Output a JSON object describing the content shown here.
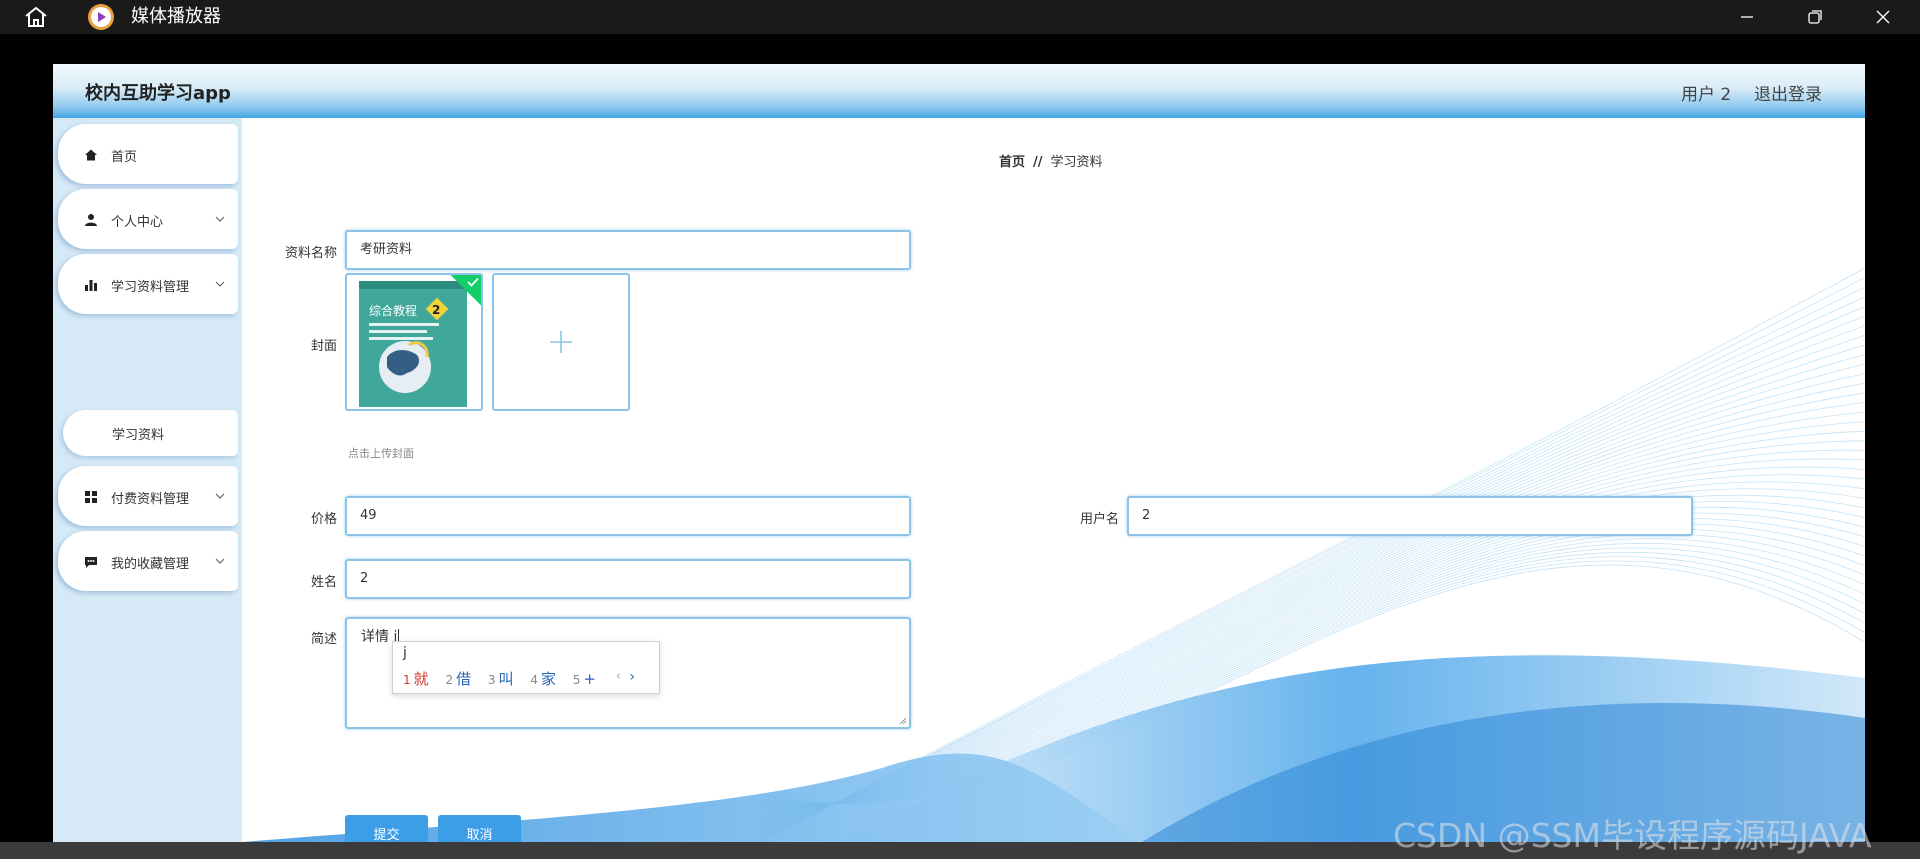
{
  "titlebar": {
    "title": "媒体播放器",
    "home_icon": "home-icon",
    "app_icon": "media-player-icon",
    "controls": [
      "minimize-icon",
      "restore-icon",
      "close-icon"
    ]
  },
  "header": {
    "brand": "校内互助学习app",
    "user": "用户 2",
    "logout": "退出登录"
  },
  "sidebar": {
    "items": [
      {
        "label": "首页",
        "icon": "home-icon",
        "expandable": false
      },
      {
        "label": "个人中心",
        "icon": "user-icon",
        "expandable": true
      },
      {
        "label": "学习资料管理",
        "icon": "bar-chart-icon",
        "expandable": true
      },
      {
        "label": "学习资料",
        "submenu": true
      },
      {
        "label": "付费资料管理",
        "icon": "grid-icon",
        "expandable": true
      },
      {
        "label": "我的收藏管理",
        "icon": "message-icon",
        "expandable": true
      }
    ]
  },
  "breadcrumb": {
    "home": "首页",
    "separator": "//",
    "current": "学习资料"
  },
  "form": {
    "name_label": "资料名称",
    "name_value": "考研资料",
    "cover_label": "封面",
    "cover_hint": "点击上传封面",
    "cover_image_text": {
      "title": "综合教程",
      "number": "2"
    },
    "price_label": "价格",
    "price_value": "49",
    "username_label": "用户名",
    "username_value": "2",
    "realname_label": "姓名",
    "realname_value": "2",
    "desc_label": "简述",
    "desc_value": "详情 j"
  },
  "ime": {
    "composition": "j",
    "candidates": [
      {
        "n": "1",
        "text": "就"
      },
      {
        "n": "2",
        "text": "借"
      },
      {
        "n": "3",
        "text": "叫"
      },
      {
        "n": "4",
        "text": "家"
      },
      {
        "n": "5",
        "text": "+"
      }
    ],
    "prev": "‹",
    "next": "›"
  },
  "buttons": {
    "submit": "提交",
    "cancel": "取消"
  },
  "watermark": "CSDN @SSM毕设程序源码JAVA",
  "colors": {
    "accent": "#3d9ee8",
    "input_border": "#8cc3e6",
    "sidebar_bg": "#d6e9f6",
    "check": "#13ce66"
  }
}
